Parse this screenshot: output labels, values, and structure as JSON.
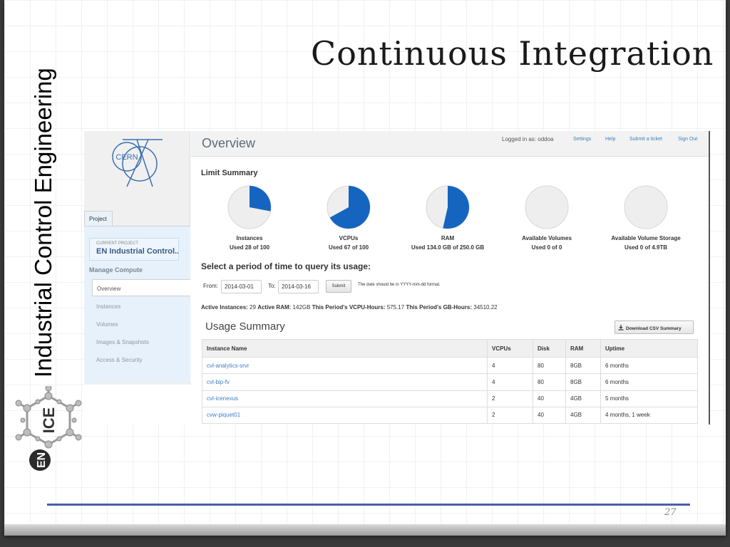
{
  "slide": {
    "title": "Continuous Integration",
    "side_label": "Industrial Control Engineering",
    "page_number": "27",
    "logo_text": "EN ICE"
  },
  "dashboard": {
    "logo_text": "CERN",
    "title": "Overview",
    "logged_in": "Logged in as: oddoa",
    "top_links": [
      "Settings",
      "Help",
      "Submit a ticket",
      "Sign Out"
    ],
    "sidebar": {
      "tab": "Project",
      "current_project_caption": "CURRENT PROJECT",
      "current_project": "EN Industrial Control...",
      "section": "Manage Compute",
      "items": [
        "Overview",
        "Instances",
        "Volumes",
        "Images & Snapshots",
        "Access & Security"
      ]
    },
    "limit_summary": {
      "title": "Limit Summary",
      "charts": [
        {
          "label": "Instances",
          "usage": "Used 28 of 100",
          "fraction": 0.28
        },
        {
          "label": "VCPUs",
          "usage": "Used 67 of 100",
          "fraction": 0.67
        },
        {
          "label": "RAM",
          "usage": "Used 134.0 GB of 250.0 GB",
          "fraction": 0.536
        },
        {
          "label": "Available Volumes",
          "usage": "Used 0 of 0",
          "fraction": 0
        },
        {
          "label": "Available Volume Storage",
          "usage": "Used 0 of 4.9TB",
          "fraction": 0
        }
      ]
    },
    "query": {
      "title": "Select a period of time to query its usage:",
      "from_label": "From:",
      "from_value": "2014-03-01",
      "to_label": "To:",
      "to_value": "2014-03-16",
      "submit": "Submit",
      "hint": "The date should be in YYYY-mm-dd format."
    },
    "stats": {
      "active_instances_label": "Active Instances:",
      "active_instances": "29",
      "active_ram_label": "Active RAM:",
      "active_ram": "142GB",
      "vcpu_hours_label": "This Period's VCPU-Hours:",
      "vcpu_hours": "575.17",
      "gb_hours_label": "This Period's GB-Hours:",
      "gb_hours": "34510.22"
    },
    "usage": {
      "title": "Usage Summary",
      "download": "Download CSV Summary",
      "columns": [
        "Instance Name",
        "VCPUs",
        "Disk",
        "RAM",
        "Uptime"
      ],
      "rows": [
        [
          "cvl-analytics-srvr",
          "4",
          "80",
          "8GB",
          "6 months"
        ],
        [
          "cvl-bip-fv",
          "4",
          "80",
          "8GB",
          "6 months"
        ],
        [
          "cvl-icenexus",
          "2",
          "40",
          "4GB",
          "5 months"
        ],
        [
          "cvw-piquet01",
          "2",
          "40",
          "4GB",
          "4 months, 1 week"
        ]
      ]
    },
    "colors": {
      "pie_fill": "#1565c0",
      "pie_track": "#eeeeee",
      "link": "#3f7ec0",
      "footer_rule": "#4a5fa8"
    }
  }
}
